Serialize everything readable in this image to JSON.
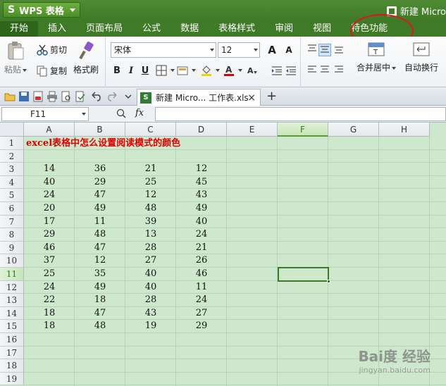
{
  "app": {
    "button_label": "WPS 表格",
    "window_title": "新建 Micro"
  },
  "ribbon_tabs": [
    {
      "label": "开始",
      "active": true
    },
    {
      "label": "插入"
    },
    {
      "label": "页面布局"
    },
    {
      "label": "公式"
    },
    {
      "label": "数据"
    },
    {
      "label": "表格样式"
    },
    {
      "label": "审阅"
    },
    {
      "label": "视图"
    },
    {
      "label": "特色功能"
    }
  ],
  "ribbon": {
    "clipboard": {
      "paste_label": "粘贴",
      "cut_label": "剪切",
      "copy_label": "复制",
      "format_painter_label": "格式刷"
    },
    "font": {
      "name": "宋体",
      "size": "12",
      "grow_label": "A",
      "shrink_label": "A",
      "bold_label": "B",
      "italic_label": "I",
      "underline_label": "U"
    },
    "alignment": {
      "merge_center_label": "合并居中",
      "wrap_text_label": "自动换行"
    }
  },
  "document_tab": {
    "name": "新建 Micro... 工作表.xls",
    "close_label": "×",
    "new_tab_label": "+"
  },
  "formula_bar": {
    "name_box": "F11",
    "fx_label": "fx",
    "value": ""
  },
  "sheet": {
    "columns": [
      "A",
      "B",
      "C",
      "D",
      "E",
      "F",
      "G",
      "H"
    ],
    "selected_column": "F",
    "rows": [
      "1",
      "2",
      "3",
      "4",
      "5",
      "6",
      "7",
      "8",
      "9",
      "10",
      "11",
      "12",
      "13",
      "14",
      "15",
      "16",
      "17",
      "18",
      "19"
    ],
    "selected_row": "11",
    "title": "excel表格中怎么设置阅读模式的颜色",
    "data": [
      [
        14,
        36,
        21,
        12
      ],
      [
        40,
        29,
        25,
        45
      ],
      [
        24,
        47,
        12,
        43
      ],
      [
        20,
        49,
        48,
        49
      ],
      [
        17,
        11,
        39,
        40
      ],
      [
        29,
        48,
        13,
        24
      ],
      [
        46,
        47,
        28,
        21
      ],
      [
        37,
        12,
        27,
        26
      ],
      [
        25,
        35,
        40,
        46
      ],
      [
        24,
        49,
        40,
        11
      ],
      [
        22,
        18,
        28,
        24
      ],
      [
        18,
        47,
        43,
        27
      ],
      [
        18,
        48,
        19,
        29
      ]
    ]
  },
  "watermark": {
    "brand": "Bai度 经验",
    "url": "jingyan.baidu.com"
  },
  "colors": {
    "ribbon_green": "#3f7a27",
    "grid_reading_mode": "#cde8cd",
    "highlight_red": "#e0141c",
    "title_red": "#e30000"
  }
}
